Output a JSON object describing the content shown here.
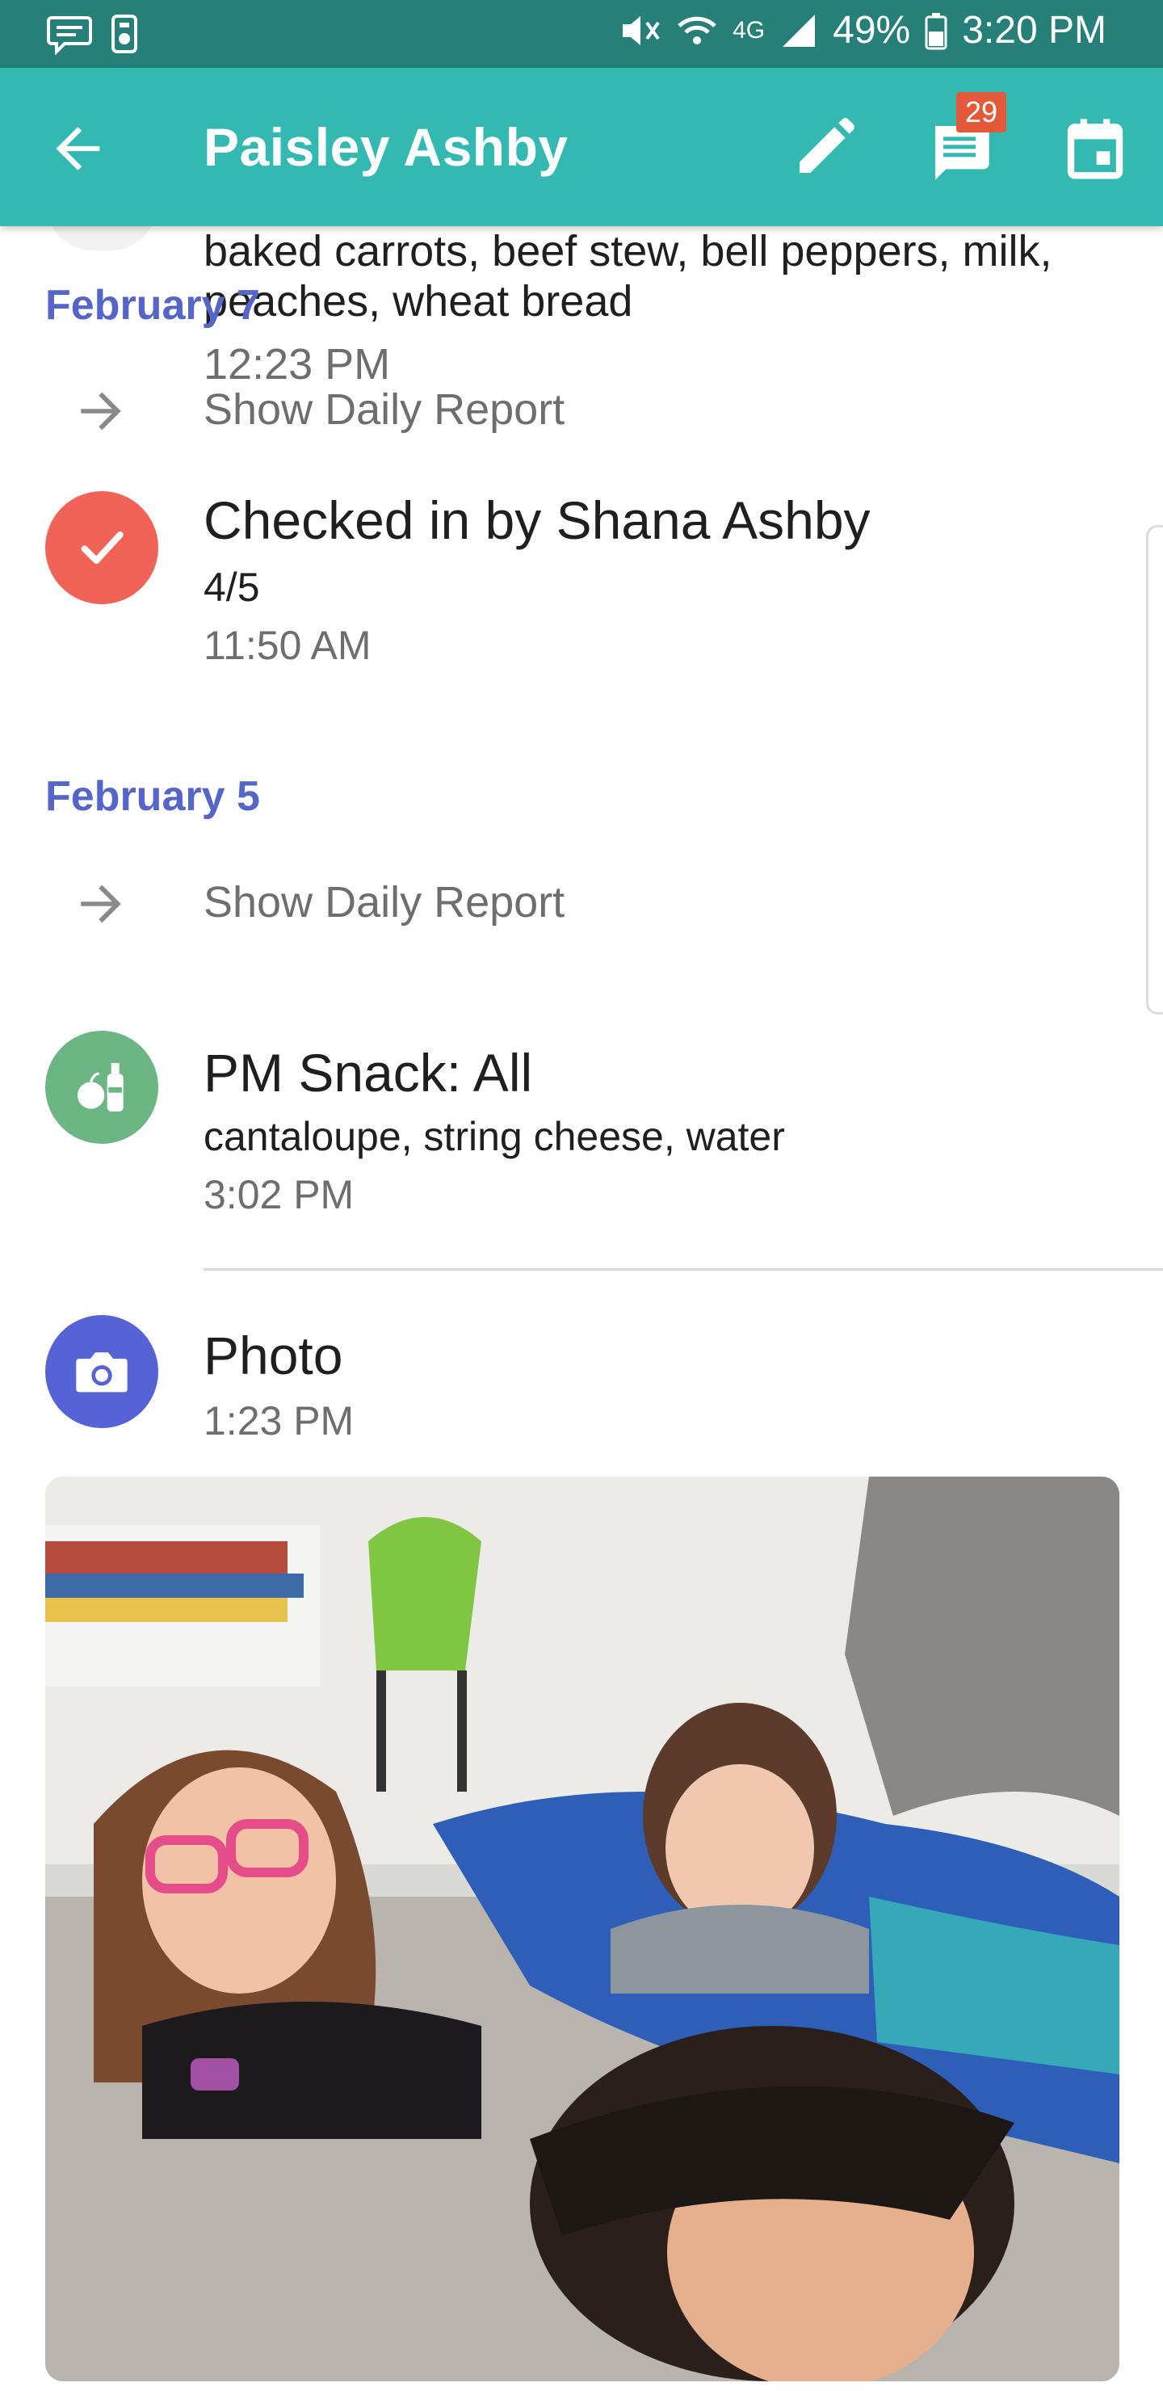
{
  "status_bar": {
    "battery": "49%",
    "time": "3:20 PM",
    "network": "4G"
  },
  "header": {
    "title": "Paisley Ashby",
    "chat_badge": "29"
  },
  "feed": {
    "faded_entry": {
      "details_line1": "baked carrots, beef stew, bell peppers, milk,",
      "details_line2": "peaches, wheat bread",
      "time": "12:23 PM"
    },
    "sections": [
      {
        "date": "February 7",
        "report_link": "Show Daily Report",
        "events": [
          {
            "type": "checkin",
            "title": "Checked in by Shana Ashby",
            "detail": "4/5",
            "time": "11:50 AM"
          }
        ]
      },
      {
        "date": "February 5",
        "report_link": "Show Daily Report",
        "events": [
          {
            "type": "snack",
            "title": "PM Snack: All",
            "detail": "cantaloupe, string cheese, water",
            "time": "3:02 PM"
          },
          {
            "type": "photo",
            "title": "Photo",
            "time": "1:23 PM"
          }
        ]
      }
    ]
  },
  "colors": {
    "status_bar": "#268077",
    "app_bar": "#33b9b2",
    "date_heading": "#5565c9",
    "checkin_avatar": "#f06356",
    "snack_avatar": "#6bb682",
    "photo_avatar": "#5563d6",
    "badge": "#e4593a"
  },
  "icons": {
    "back": "arrow-left-icon",
    "edit": "pencil-icon",
    "chat": "chat-bubble-icon",
    "calendar": "calendar-icon",
    "report_arrow": "arrow-right-icon",
    "checkin": "checkmark-icon",
    "snack": "apple-bottle-icon",
    "photo": "camera-icon"
  }
}
